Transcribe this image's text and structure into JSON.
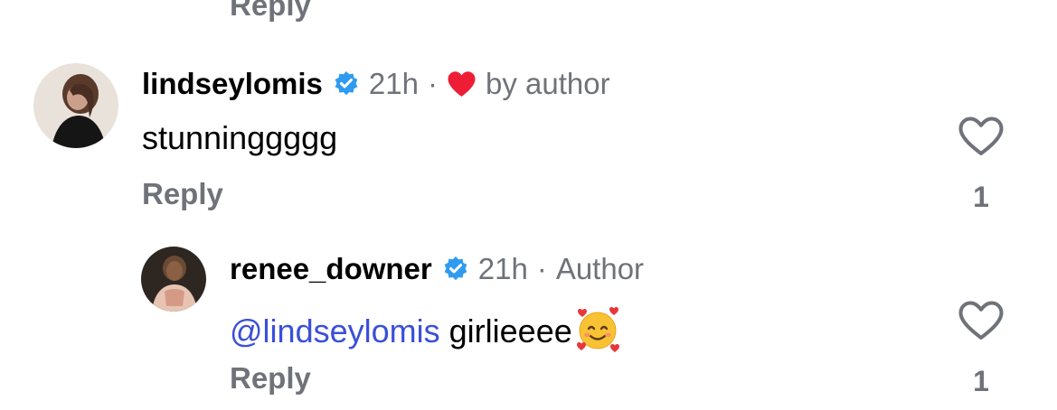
{
  "previous_comment": {
    "reply_label": "Reply"
  },
  "comments": [
    {
      "username": "lindseylomis",
      "verified": true,
      "time": "21h",
      "separator": "·",
      "liked_by_author_label": "by author",
      "text": "stunninggggg",
      "reply_label": "Reply",
      "like_count": "1"
    },
    {
      "username": "renee_downer",
      "verified": true,
      "time": "21h",
      "separator": "·",
      "author_badge": "Author",
      "mention": "@lindseylomis",
      "text": "girlieeee",
      "emoji": "smiling-face-with-hearts",
      "reply_label": "Reply",
      "like_count": "1"
    }
  ],
  "colors": {
    "verified_badge": "#2f9bf0",
    "liked_heart": "#ee1d36",
    "mention": "#3a4fd8",
    "muted_text": "#6f7379"
  }
}
